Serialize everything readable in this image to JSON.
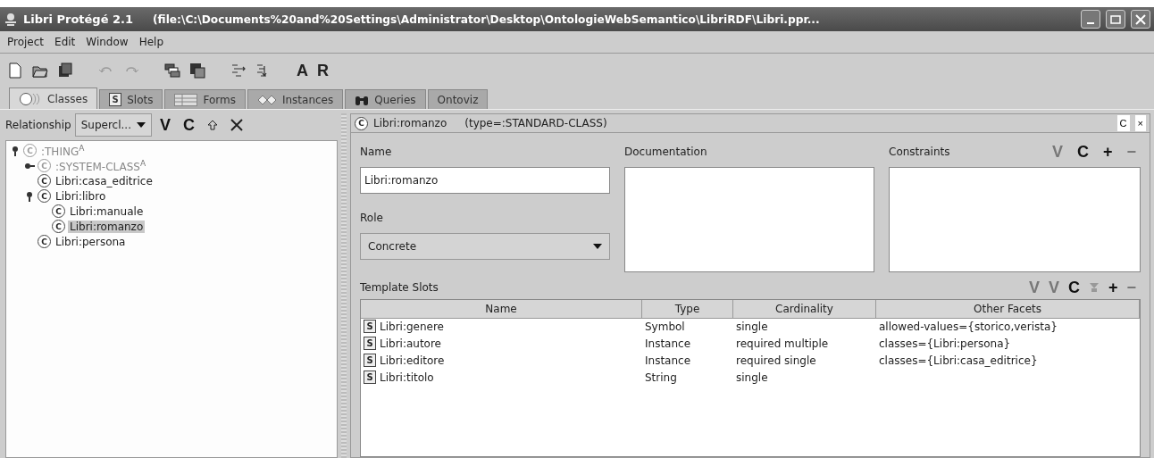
{
  "window": {
    "title": "Libri  Protégé 2.1",
    "path": "(file:\\C:\\Documents%20and%20Settings\\Administrator\\Desktop\\OntologieWebSemantico\\LibriRDF\\Libri.ppr..."
  },
  "menu": [
    "Project",
    "Edit",
    "Window",
    "Help"
  ],
  "toolbar": {
    "letters": [
      "A",
      "R"
    ]
  },
  "tabs": [
    {
      "label": "Classes",
      "kind": "classes",
      "selected": true
    },
    {
      "label": "Slots",
      "kind": "slots",
      "icon_letter": "S",
      "selected": false
    },
    {
      "label": "Forms",
      "kind": "forms",
      "selected": false
    },
    {
      "label": "Instances",
      "kind": "instances",
      "selected": false
    },
    {
      "label": "Queries",
      "kind": "queries",
      "selected": false
    },
    {
      "label": "Ontoviz",
      "kind": "plain",
      "selected": false
    }
  ],
  "class_browser": {
    "relationship_label": "Relationship",
    "relationship_value": "Supercl...",
    "buttons": [
      {
        "kind": "text",
        "label": "V"
      },
      {
        "kind": "text",
        "label": "C"
      },
      {
        "kind": "up"
      },
      {
        "kind": "delete"
      }
    ],
    "tree": [
      {
        "label": ":THING",
        "icon_letter": "C",
        "badge": "A",
        "dimmed": true,
        "selected": false,
        "expanded": true,
        "children": [
          {
            "label": ":SYSTEM-CLASS",
            "icon_letter": "C",
            "badge": "A",
            "dimmed": true,
            "selected": false,
            "expanded": false
          },
          {
            "label": "Libri:casa_editrice",
            "icon_letter": "C",
            "dimmed": false,
            "selected": false
          },
          {
            "label": "Libri:libro",
            "icon_letter": "C",
            "dimmed": false,
            "selected": false,
            "expanded": true,
            "children": [
              {
                "label": "Libri:manuale",
                "icon_letter": "C",
                "dimmed": false,
                "selected": false
              },
              {
                "label": "Libri:romanzo",
                "icon_letter": "C",
                "dimmed": false,
                "selected": true
              }
            ]
          },
          {
            "label": "Libri:persona",
            "icon_letter": "C",
            "dimmed": false,
            "selected": false
          }
        ]
      }
    ]
  },
  "class_editor": {
    "icon_letter": "C",
    "title": "Libri:romanzo",
    "type": "(type=:STANDARD-CLASS)",
    "corner_buttons": [
      "C",
      "×"
    ],
    "name_label": "Name",
    "name_value": "Libri:romanzo",
    "role_label": "Role",
    "role_value": "Concrete",
    "documentation_label": "Documentation",
    "constraints_label": "Constraints",
    "constraint_buttons": [
      {
        "label": "V",
        "disabled": true
      },
      {
        "label": "C",
        "disabled": false
      },
      {
        "label": "+",
        "disabled": false
      },
      {
        "label": "−",
        "disabled": true
      }
    ],
    "template_slots": {
      "label": "Template Slots",
      "buttons": [
        {
          "kind": "text",
          "label": "V",
          "disabled": true
        },
        {
          "kind": "text",
          "label": "V",
          "disabled": true
        },
        {
          "kind": "text",
          "label": "C",
          "disabled": false
        },
        {
          "kind": "remove",
          "disabled": true
        },
        {
          "kind": "text",
          "label": "+",
          "disabled": false
        },
        {
          "kind": "text",
          "label": "−",
          "disabled": true
        }
      ],
      "columns": [
        "Name",
        "Type",
        "Cardinality",
        "Other Facets"
      ],
      "rows": [
        {
          "icon_letter": "S",
          "name": "Libri:genere",
          "type": "Symbol",
          "cardinality": "single",
          "facets": "allowed-values={storico,verista}"
        },
        {
          "icon_letter": "S",
          "name": "Libri:autore",
          "type": "Instance",
          "cardinality": "required multiple",
          "facets": "classes={Libri:persona}"
        },
        {
          "icon_letter": "S",
          "name": "Libri:editore",
          "type": "Instance",
          "cardinality": "required single",
          "facets": "classes={Libri:casa_editrice}"
        },
        {
          "icon_letter": "S",
          "name": "Libri:titolo",
          "type": "String",
          "cardinality": "single"
        }
      ]
    }
  }
}
